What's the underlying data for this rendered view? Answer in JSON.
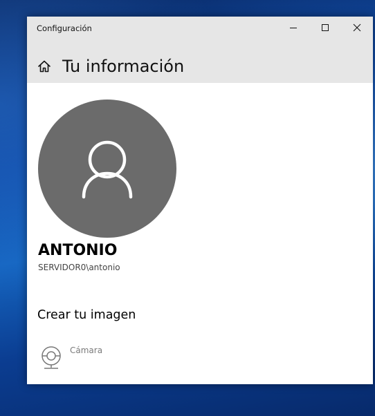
{
  "window": {
    "title": "Configuración"
  },
  "header": {
    "home_icon": "home-icon",
    "title": "Tu información"
  },
  "user": {
    "avatar_icon": "person-icon",
    "name": "ANTONIO",
    "account": "SERVIDOR0\\antonio"
  },
  "create_picture": {
    "heading": "Crear tu imagen",
    "items": [
      {
        "icon": "camera-icon",
        "label": "Cámara"
      }
    ]
  },
  "colors": {
    "titlebar_bg": "#e6e6e6",
    "window_bg": "#ffffff",
    "avatar_bg": "#6b6b6b",
    "disabled_text": "#7a7a7a"
  }
}
